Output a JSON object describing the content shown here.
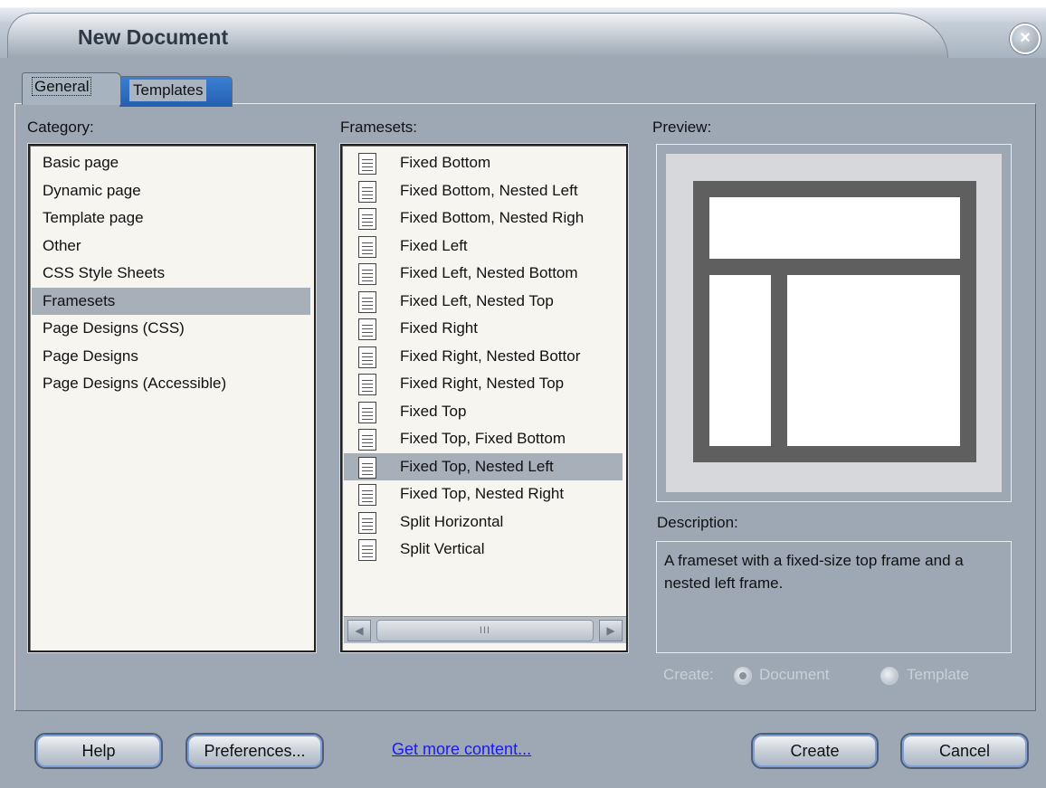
{
  "window": {
    "title": "New Document",
    "close_symbol": "×"
  },
  "tabs": [
    {
      "label": "General",
      "active": true
    },
    {
      "label": "Templates",
      "active": false
    }
  ],
  "category": {
    "label": "Category:",
    "items": [
      "Basic page",
      "Dynamic page",
      "Template page",
      "Other",
      "CSS Style Sheets",
      "Framesets",
      "Page Designs (CSS)",
      "Page Designs",
      "Page Designs (Accessible)"
    ],
    "selected": "Framesets"
  },
  "framesets": {
    "label": "Framesets:",
    "items": [
      "Fixed Bottom",
      "Fixed Bottom, Nested Left",
      "Fixed Bottom, Nested Righ",
      "Fixed Left",
      "Fixed Left, Nested Bottom",
      "Fixed Left, Nested Top",
      "Fixed Right",
      "Fixed Right, Nested Bottor",
      "Fixed Right, Nested Top",
      "Fixed Top",
      "Fixed Top, Fixed Bottom",
      "Fixed Top, Nested Left",
      "Fixed Top, Nested Right",
      "Split Horizontal",
      "Split Vertical"
    ],
    "selected": "Fixed Top, Nested Left",
    "icon": "document-icon",
    "scroll_thumb": "III"
  },
  "preview": {
    "label": "Preview:"
  },
  "description": {
    "label": "Description:",
    "text": "A frameset with a fixed-size top frame and a nested left frame."
  },
  "create": {
    "label": "Create:",
    "options": [
      {
        "label": "Document",
        "checked": true
      },
      {
        "label": "Template",
        "checked": false
      }
    ]
  },
  "buttons": {
    "help": "Help",
    "preferences": "Preferences...",
    "get_more": "Get more content...",
    "create": "Create",
    "cancel": "Cancel"
  },
  "colors": {
    "selection": "#a7b0b9",
    "dialog_bg": "#9da8b4",
    "list_bg": "#f6f5f0",
    "link": "#1a1aee"
  }
}
